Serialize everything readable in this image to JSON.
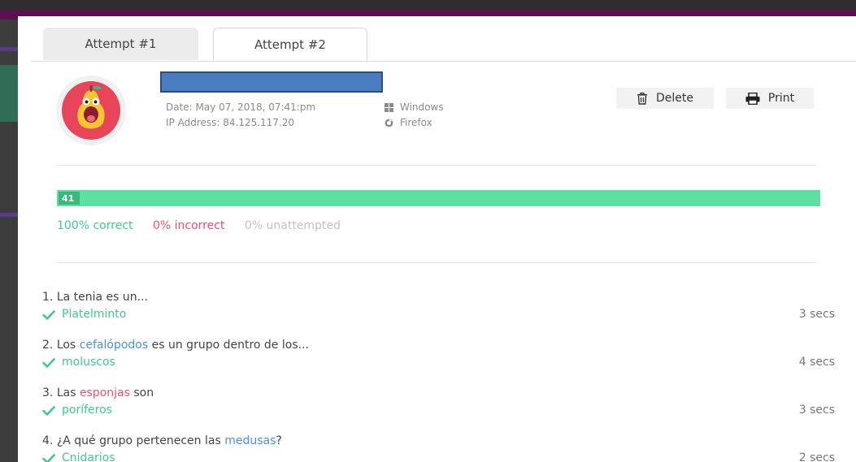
{
  "tabs": [
    {
      "label": "Attempt #1",
      "active": false
    },
    {
      "label": "Attempt #2",
      "active": true
    }
  ],
  "attempt": {
    "date": "Date: May 07, 2018, 07:41:pm",
    "ip": "IP Address: 84.125.117.20",
    "os": "Windows",
    "browser": "Firefox"
  },
  "actions": {
    "delete_label": "Delete",
    "print_label": "Print"
  },
  "progress": {
    "count": "41",
    "correct_fraction": 1.0,
    "correct_color": "#5fe0a3"
  },
  "stats": {
    "correct": "100% correct",
    "incorrect": "0% incorrect",
    "unattempted": "0% unattempted"
  },
  "questions": [
    {
      "number": "1.",
      "before": "La tenia es un...",
      "highlight": "",
      "after": "",
      "highlight_color": "",
      "answer": "Platelminto",
      "time": "3 secs"
    },
    {
      "number": "2.",
      "before": "Los ",
      "highlight": "cefalópodos",
      "after": " es un grupo dentro de los...",
      "highlight_color": "blue",
      "answer": "moluscos",
      "time": "4 secs"
    },
    {
      "number": "3.",
      "before": "Las ",
      "highlight": "esponjas",
      "after": " son",
      "highlight_color": "red",
      "answer": "poríferos",
      "time": "3 secs"
    },
    {
      "number": "4.",
      "before": "¿A qué grupo pertenecen las ",
      "highlight": "medusas",
      "after": "?",
      "highlight_color": "blue",
      "answer": "Cnidarios",
      "time": "2 secs"
    }
  ],
  "icons": {
    "os": "windows-icon",
    "browser": "firefox-icon",
    "delete": "trash-icon",
    "print": "printer-icon",
    "answer": "check-icon"
  }
}
